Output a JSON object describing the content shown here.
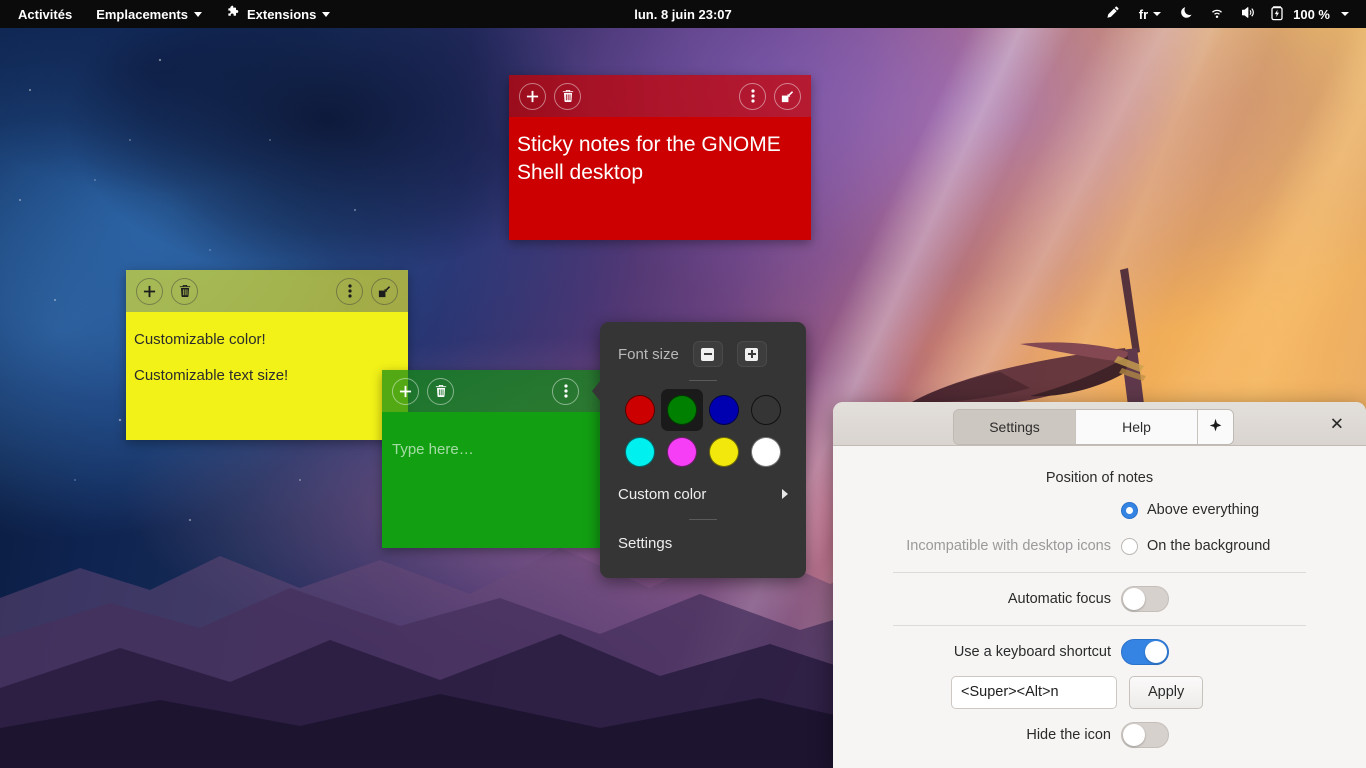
{
  "topbar": {
    "activities": "Activités",
    "places": "Emplacements",
    "extensions": "Extensions",
    "clock": "lun. 8 juin  23:07",
    "keyboard_layout": "fr",
    "battery_percent": "100 %",
    "icons": {
      "pencil": "pencil-icon",
      "night_light": "moon-icon",
      "wifi": "wifi-icon",
      "volume": "volume-icon",
      "battery": "battery-charging-icon"
    }
  },
  "notes": [
    {
      "id": "red",
      "color": "#cc0000",
      "text_color": "#ffffff",
      "lines": [
        "Sticky notes for the GNOME Shell desktop"
      ],
      "buttons": {
        "add": "new-note",
        "delete": "delete-note",
        "menu": "note-menu",
        "resize": "resize-note"
      }
    },
    {
      "id": "yellow",
      "color": "#f2f218",
      "text_color": "#2b2b2b",
      "lines": [
        "Customizable color!",
        "Customizable text size!"
      ],
      "buttons": {
        "add": "new-note",
        "delete": "delete-note",
        "menu": "note-menu",
        "resize": "resize-note"
      }
    },
    {
      "id": "green",
      "color": "#12a012",
      "text_color": "#ffffff",
      "placeholder": "Type here…",
      "buttons": {
        "add": "new-note",
        "delete": "delete-note",
        "menu": "note-menu"
      }
    }
  ],
  "popup_menu": {
    "font_size_label": "Font size",
    "font_decrease_label": "−",
    "font_increase_label": "+",
    "swatches": [
      {
        "name": "red",
        "hex": "#cc0000",
        "selected": false
      },
      {
        "name": "green",
        "hex": "#008000",
        "selected": true
      },
      {
        "name": "blue",
        "hex": "#0000b0",
        "selected": false
      },
      {
        "name": "black",
        "hex": "#353535",
        "selected": false
      },
      {
        "name": "cyan",
        "hex": "#00f0f0",
        "selected": false
      },
      {
        "name": "magenta",
        "hex": "#f73ef7",
        "selected": false
      },
      {
        "name": "yellow",
        "hex": "#f2e80c",
        "selected": false
      },
      {
        "name": "white",
        "hex": "#ffffff",
        "selected": false
      }
    ],
    "custom_color": "Custom color",
    "settings": "Settings"
  },
  "settings_window": {
    "tabs": [
      {
        "label": "Settings",
        "active": true
      },
      {
        "label": "Help",
        "active": false
      }
    ],
    "extra_tab_icon": "sparkle-icon",
    "close_label": "✕",
    "position_section_title": "Position of notes",
    "rows": {
      "above_everything": "Above everything",
      "on_the_background": "On the background",
      "incompatible_note": "Incompatible with desktop icons",
      "automatic_focus": "Automatic focus",
      "use_keyboard_shortcut": "Use a keyboard shortcut",
      "shortcut_value": "<Super><Alt>n",
      "shortcut_placeholder": "<Super><Alt>n",
      "apply": "Apply",
      "hide_the_icon": "Hide the icon"
    },
    "states": {
      "position_selected": "above_everything",
      "automatic_focus_on": false,
      "use_keyboard_shortcut_on": true,
      "hide_the_icon_on": false
    },
    "accent_color": "#3584e4"
  }
}
